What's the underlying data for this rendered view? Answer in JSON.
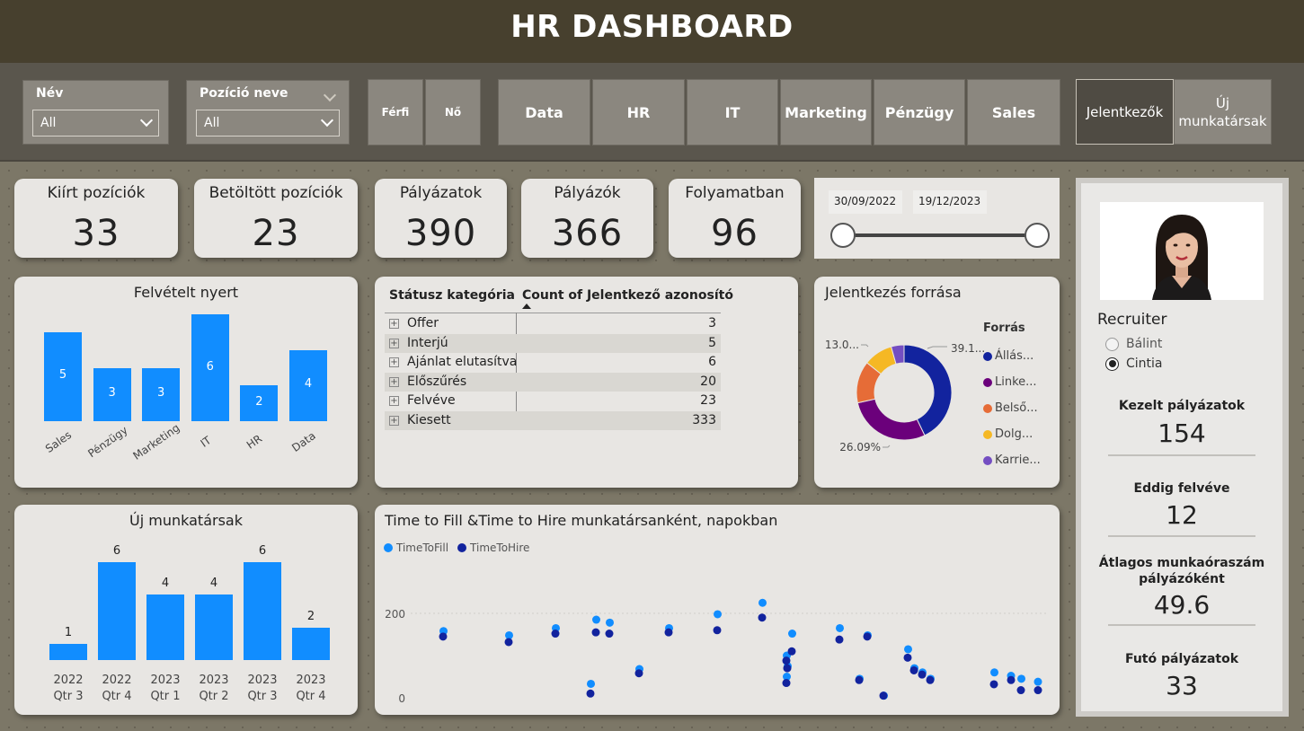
{
  "header": {
    "title": "HR DASHBOARD"
  },
  "filters": {
    "nev": {
      "label": "Név",
      "value": "All"
    },
    "pozicio": {
      "label": "Pozíció neve",
      "value": "All"
    },
    "gender": [
      "Férfi",
      "Nő"
    ],
    "departments": [
      "Data",
      "HR",
      "IT",
      "Marketing",
      "Pénzügy",
      "Sales"
    ],
    "view": {
      "active": "Jelentkezők",
      "other_line1": "Új",
      "other_line2": "munkatársak"
    }
  },
  "kpis": [
    {
      "label": "Kiírt pozíciók",
      "value": "33"
    },
    {
      "label": "Betöltött pozíciók",
      "value": "23"
    },
    {
      "label": "Pályázatok",
      "value": "390"
    },
    {
      "label": "Pályázók",
      "value": "366"
    },
    {
      "label": "Folyamatban",
      "value": "96"
    }
  ],
  "date_range": {
    "start": "30/09/2022",
    "end": "19/12/2023"
  },
  "hired_chart": {
    "title": "Felvételt nyert",
    "chart_data": {
      "type": "bar",
      "categories": [
        "Sales",
        "Pénzügy",
        "Marketing",
        "IT",
        "HR",
        "Data"
      ],
      "values": [
        5,
        3,
        3,
        6,
        2,
        4
      ],
      "title": "Felvételt nyert"
    }
  },
  "status_table": {
    "headers": [
      "Státusz kategória",
      "Count of Jelentkező azonosító"
    ],
    "rows": [
      {
        "label": "Offer",
        "value": "3"
      },
      {
        "label": "Interjú",
        "value": "5"
      },
      {
        "label": "Ajánlat elutasítva",
        "value": "6"
      },
      {
        "label": "Előszűrés",
        "value": "20"
      },
      {
        "label": "Felvéve",
        "value": "23"
      },
      {
        "label": "Kiesett",
        "value": "333"
      }
    ]
  },
  "source_chart": {
    "title": "Jelentkezés forrása",
    "legend_title": "Forrás",
    "chart_data": {
      "type": "pie",
      "title": "Jelentkezés forrása",
      "labels": [
        "Állás...",
        "Linke...",
        "Belső...",
        "Dolg...",
        "Karrie..."
      ],
      "values": [
        39.1,
        26.09,
        13.0,
        9.0,
        4.0
      ],
      "data_labels": [
        "39.1...",
        "26.09%",
        "13.0..."
      ],
      "colors": [
        "#12239e",
        "#6b007b",
        "#e66c37",
        "#f5b824",
        "#744ec2"
      ]
    }
  },
  "new_hires_chart": {
    "title": "Új munkatársak",
    "chart_data": {
      "type": "bar",
      "categories": [
        "2022 Qtr 3",
        "2022 Qtr 4",
        "2023 Qtr 1",
        "2023 Qtr 2",
        "2023 Qtr 3",
        "2023 Qtr 4"
      ],
      "cat_line1": [
        "2022",
        "2022",
        "2023",
        "2023",
        "2023",
        "2023"
      ],
      "cat_line2": [
        "Qtr 3",
        "Qtr 4",
        "Qtr 1",
        "Qtr 2",
        "Qtr 3",
        "Qtr 4"
      ],
      "values": [
        1,
        6,
        4,
        4,
        6,
        2
      ],
      "title": "Új munkatársak"
    }
  },
  "scatter_chart": {
    "title": "Time to Fill &Time to Hire munkatársanként, napokban",
    "chart_data": {
      "type": "scatter",
      "title": "Time to Fill &Time to Hire munkatársanként, napokban",
      "y_ticks": [
        "200",
        "0"
      ],
      "ylim": [
        0,
        250
      ],
      "series": [
        {
          "name": "TimeToFill",
          "color": "#118dff",
          "values": [
            158,
            148,
            165,
            33,
            185,
            178,
            68,
            165,
            198,
            225,
            152,
            100,
            75,
            50,
            165,
            45,
            148,
            5,
            115,
            70,
            60,
            45,
            60,
            45
          ]
        },
        {
          "name": "TimeToHire",
          "color": "#12239e",
          "values": [
            145,
            132,
            152,
            10,
            155,
            152,
            58,
            155,
            160,
            190,
            110,
            88,
            70,
            35,
            138,
            42,
            145,
            5,
            95,
            65,
            55,
            42,
            32,
            18
          ]
        }
      ]
    }
  },
  "recruiter_panel": {
    "title": "Recruiter",
    "options": [
      "Bálint",
      "Cintia"
    ],
    "selected": "Cintia",
    "metrics": [
      {
        "label": "Kezelt pályázatok",
        "value": "154"
      },
      {
        "label": "Eddig felvéve",
        "value": "12"
      },
      {
        "label": "Átlagos munkaóraszám pályázóként",
        "value": "49.6"
      },
      {
        "label": "Futó pályázatok",
        "value": "33"
      }
    ]
  }
}
